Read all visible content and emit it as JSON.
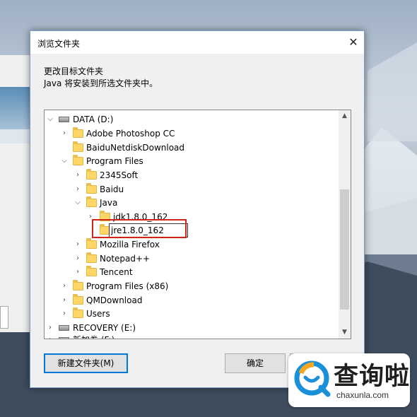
{
  "dialog": {
    "title": "浏览文件夹",
    "close_glyph": "✕",
    "instruction_line1": "更改目标文件夹",
    "instruction_line2": "Java 将安装到所选文件夹中。"
  },
  "tree": {
    "items": [
      {
        "label": "DATA (D:)",
        "icon": "drive-icon",
        "state": "expanded"
      },
      {
        "label": "Adobe Photoshop CC",
        "icon": "folder-icon",
        "state": "collapsed"
      },
      {
        "label": "BaiduNetdiskDownload",
        "icon": "folder-icon",
        "state": "none"
      },
      {
        "label": "Program Files",
        "icon": "folder-icon",
        "state": "expanded"
      },
      {
        "label": "2345Soft",
        "icon": "folder-icon",
        "state": "collapsed"
      },
      {
        "label": "Baidu",
        "icon": "folder-icon",
        "state": "collapsed"
      },
      {
        "label": "Java",
        "icon": "folder-icon",
        "state": "expanded"
      },
      {
        "label": "jdk1.8.0_162",
        "icon": "folder-icon",
        "state": "collapsed"
      },
      {
        "label": "jre1.8.0_162",
        "icon": "folder-icon",
        "state": "editing"
      },
      {
        "label": "Mozilla Firefox",
        "icon": "folder-icon",
        "state": "collapsed"
      },
      {
        "label": "Notepad++",
        "icon": "folder-icon",
        "state": "collapsed"
      },
      {
        "label": "Tencent",
        "icon": "folder-icon",
        "state": "collapsed"
      },
      {
        "label": "Program Files (x86)",
        "icon": "folder-icon",
        "state": "collapsed"
      },
      {
        "label": "QMDownload",
        "icon": "folder-icon",
        "state": "collapsed"
      },
      {
        "label": "Users",
        "icon": "folder-icon",
        "state": "collapsed"
      },
      {
        "label": "RECOVERY (E:)",
        "icon": "drive-icon",
        "state": "collapsed"
      },
      {
        "label": "新加卷 (F:)",
        "icon": "drive-icon",
        "state": "collapsed"
      }
    ]
  },
  "buttons": {
    "new_folder": "新建文件夹(M)",
    "ok": "确定"
  },
  "watermark": {
    "brand_cn": "查询啦",
    "brand_url": "chaxunla.com"
  },
  "colors": {
    "highlight_box": "#d0231a",
    "folder": "#ffd768",
    "accent": "#0078d7"
  }
}
